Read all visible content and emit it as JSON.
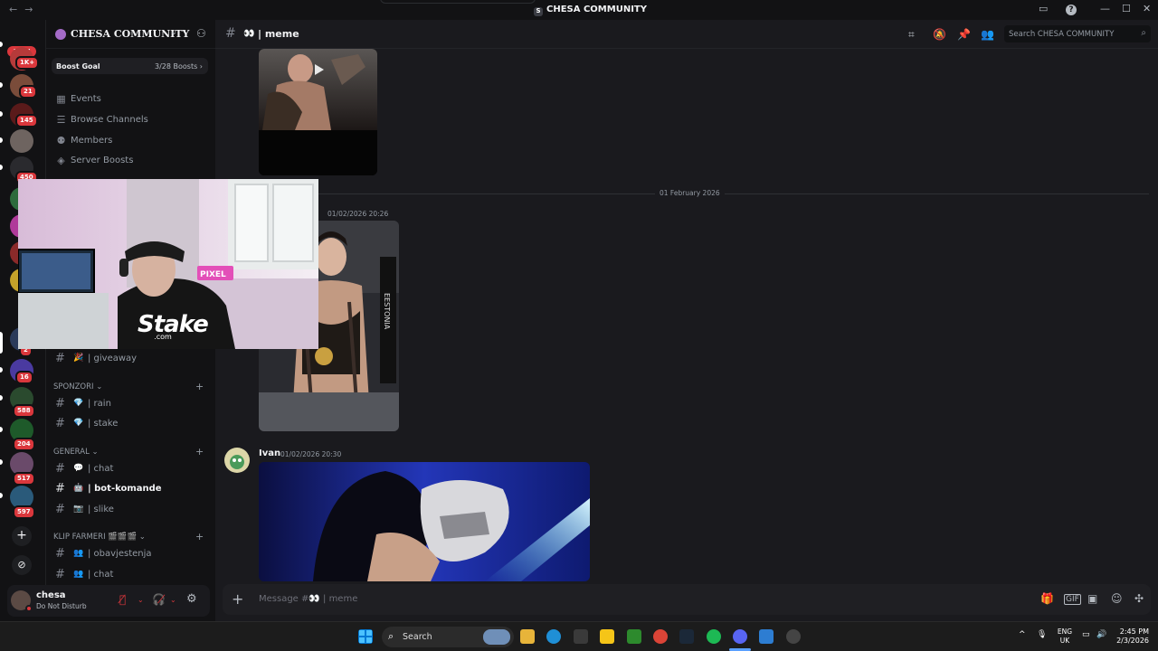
{
  "window": {
    "title": "CHESA COMMUNITY",
    "nav_back": "←",
    "nav_forward": "→",
    "controls": [
      "▭",
      "?",
      "—",
      "☐",
      "✕"
    ]
  },
  "servers": {
    "new_badge": "NEW",
    "badges": [
      "1K+",
      "21",
      "145",
      "450",
      "2",
      "16",
      "588",
      "204",
      "517",
      "597"
    ]
  },
  "sidebar": {
    "server_name": "CHESA COMMUNITY",
    "boost_goal_label": "Boost Goal",
    "boost_progress": "3/28 Boosts",
    "boost_fraction": 0.107,
    "nav": [
      {
        "label": "Events",
        "icon": "calendar-icon"
      },
      {
        "label": "Browse Channels",
        "icon": "list-icon"
      },
      {
        "label": "Members",
        "icon": "members-icon"
      },
      {
        "label": "Server Boosts",
        "icon": "boost-icon"
      }
    ],
    "giveaway": {
      "emoji": "🎉",
      "label": "| giveaway"
    },
    "categories": [
      {
        "name": "SPONZORI",
        "channels": [
          {
            "emoji": "💎",
            "label": "| rain"
          },
          {
            "emoji": "💎",
            "label": "| stake"
          }
        ]
      },
      {
        "name": "GENERAL",
        "channels": [
          {
            "emoji": "💬",
            "label": "| chat"
          },
          {
            "emoji": "🤖",
            "label": "| bot-komande",
            "active": true
          },
          {
            "emoji": "📷",
            "label": "| slike"
          }
        ]
      },
      {
        "name": "KLIP FARMERI 🎬🎬🎬",
        "channels": [
          {
            "emoji": "👥",
            "label": "| obavjestenja"
          },
          {
            "emoji": "👥",
            "label": "| chat"
          }
        ]
      }
    ]
  },
  "user": {
    "name": "chesa",
    "status": "Do Not Disturb"
  },
  "channel_header": {
    "emoji": "👀",
    "name": "| meme",
    "search_placeholder": "Search CHESA COMMUNITY"
  },
  "messages": {
    "date_divider": "01 February 2026",
    "first_timestamp": "01/02/2026 20:26",
    "second_author": "Ivan",
    "second_timestamp": "01/02/2026 20:30"
  },
  "composer": {
    "placeholder": "Message #👀 | meme"
  },
  "webcam": {
    "overlay_text": "Stake",
    "overlay_sub": ".com"
  },
  "taskbar": {
    "search_label": "Search",
    "language": "ENG",
    "region": "UK",
    "time": "2:45 PM",
    "date": "2/3/2026"
  },
  "colors": {
    "accent": "#5865f2",
    "danger": "#da373c",
    "background": "#1a1a1e"
  }
}
